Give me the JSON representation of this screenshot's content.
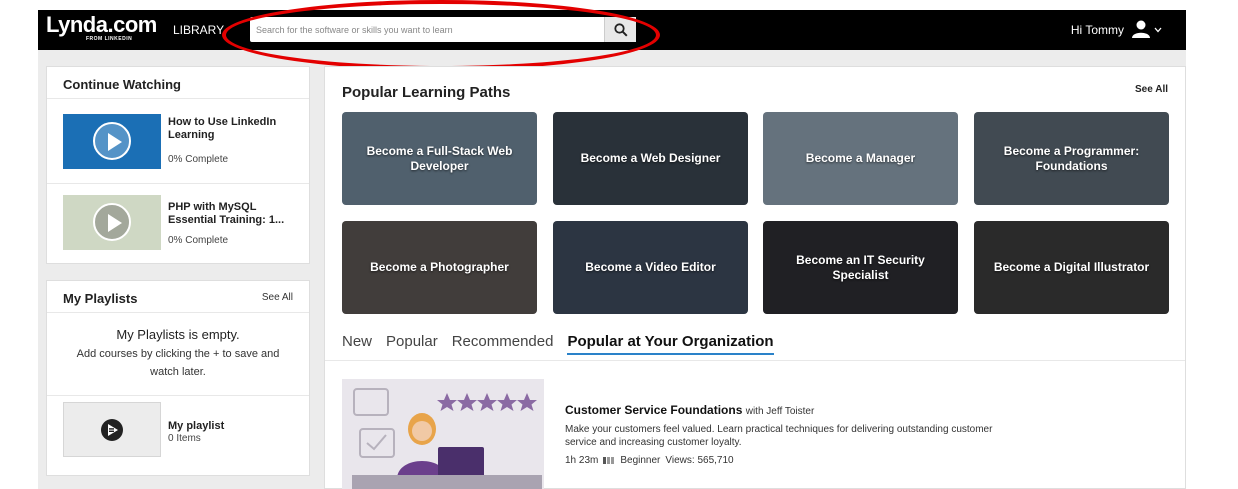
{
  "header": {
    "logo": "Lynda.com",
    "logo_sub": "FROM LINKEDIN",
    "library_label": "LIBRARY",
    "search_placeholder": "Search for the software or skills you want to learn",
    "greeting": "Hi Tommy"
  },
  "continue_watching": {
    "title": "Continue Watching",
    "items": [
      {
        "title": "How to Use LinkedIn Learning",
        "progress": "0% Complete"
      },
      {
        "title": "PHP with MySQL Essential Training: 1...",
        "progress": "0% Complete"
      }
    ]
  },
  "playlists": {
    "title": "My Playlists",
    "see_all": "See All",
    "empty_title": "My Playlists is empty.",
    "empty_desc": "Add courses by clicking the + to save and watch later.",
    "playlist_name": "My playlist",
    "playlist_count": "0 Items"
  },
  "learning_paths": {
    "title": "Popular Learning Paths",
    "see_all": "See All",
    "tiles": [
      {
        "label": "Become a Full-Stack Web Developer",
        "color": "#6f8598"
      },
      {
        "label": "Become a Web Designer",
        "color": "#3a4450"
      },
      {
        "label": "Become a Manager",
        "color": "#8c9fae"
      },
      {
        "label": "Become a Programmer: Foundations",
        "color": "#5a6772"
      },
      {
        "label": "Become a Photographer",
        "color": "#5b5552"
      },
      {
        "label": "Become a Video Editor",
        "color": "#3d4a5c"
      },
      {
        "label": "Become an IT Security Specialist",
        "color": "#2d2d33"
      },
      {
        "label": "Become a Digital Illustrator",
        "color": "#3b3b3b"
      }
    ]
  },
  "tabs": [
    "New",
    "Popular",
    "Recommended",
    "Popular at Your Organization"
  ],
  "active_tab": "Popular at Your Organization",
  "course": {
    "title": "Customer Service Foundations",
    "author": "with Jeff Toister",
    "description": "Make your customers feel valued. Learn practical techniques for delivering outstanding customer service and increasing customer loyalty.",
    "duration": "1h 23m",
    "level": "Beginner",
    "views": "Views: 565,710",
    "rating_stars": 5
  },
  "colors": {
    "accent_blue": "#2a82c9",
    "annotation_red": "#e30000",
    "topbar": "#000000"
  }
}
